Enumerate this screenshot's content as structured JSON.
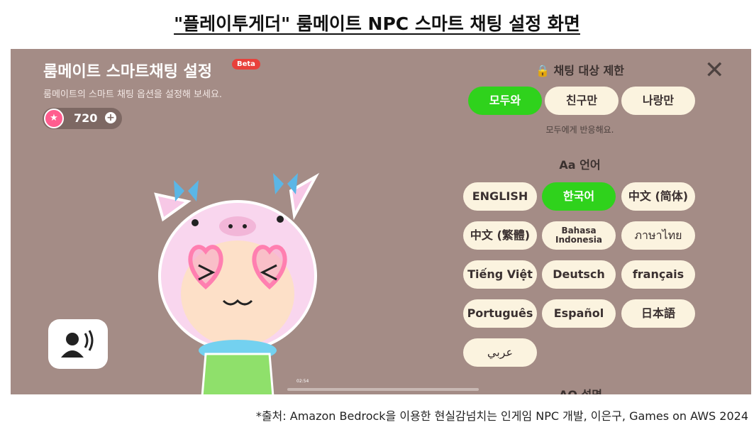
{
  "doc_title": "\"플레이투게더\" 룸메이트 NPC 스마트 채팅 설정 화면",
  "caption": "*출처: Amazon Bedrock을 이용한 현실감넘치는 인게임 NPC 개발, 이은구, Games on AWS 2024",
  "panel": {
    "title": "룸메이트 스마트채팅 설정",
    "badge": "Beta",
    "subtitle": "룸메이트의 스마트 채팅 옵션을 설정해 보세요.",
    "currency_value": "720",
    "currency_plus": "+",
    "close_icon": "close-icon"
  },
  "chat_target": {
    "heading": "🔒 채팅 대상 제한",
    "options": [
      "모두와",
      "친구만",
      "나랑만"
    ],
    "selected": "모두와",
    "note": "모두에게 반응해요."
  },
  "language": {
    "heading": "Aa 언어",
    "options": [
      "ENGLISH",
      "한국어",
      "中文 (简体)",
      "中文 (繁體)",
      "Bahasa Indonesia",
      "ภาษาไทย",
      "Tiếng Việt",
      "Deutsch",
      "français",
      "Português",
      "Español",
      "日本語",
      "عربي"
    ],
    "selected": "한국어"
  },
  "next_section_heading": "AO 설명",
  "video_time": "02:54",
  "colors": {
    "background": "#a48c86",
    "active": "#2fd21c",
    "pill": "#fbf3df"
  }
}
